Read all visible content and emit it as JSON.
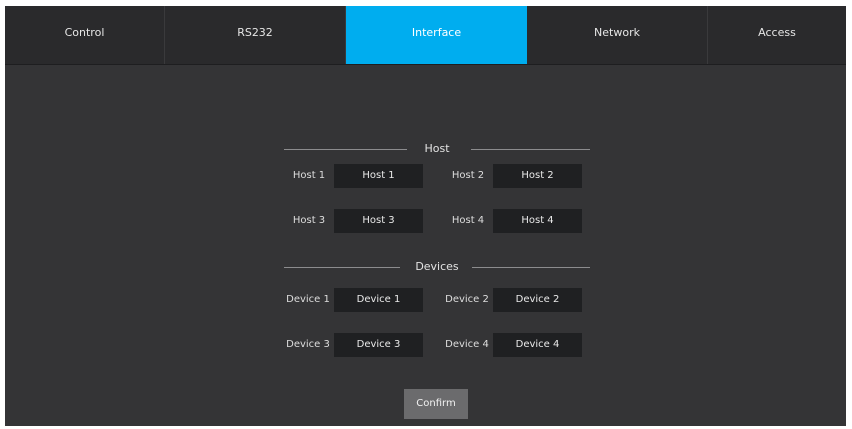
{
  "tabs": [
    {
      "label": "Control"
    },
    {
      "label": "RS232"
    },
    {
      "label": "Interface",
      "active": true
    },
    {
      "label": "Network"
    },
    {
      "label": "Access"
    }
  ],
  "host_section": {
    "title": "Host",
    "items": [
      {
        "label": "Host 1",
        "value": "Host 1"
      },
      {
        "label": "Host 2",
        "value": "Host 2"
      },
      {
        "label": "Host 3",
        "value": "Host 3"
      },
      {
        "label": "Host 4",
        "value": "Host 4"
      }
    ]
  },
  "devices_section": {
    "title": "Devices",
    "items": [
      {
        "label": "Device 1",
        "value": "Device 1"
      },
      {
        "label": "Device 2",
        "value": "Device 2"
      },
      {
        "label": "Device 3",
        "value": "Device 3"
      },
      {
        "label": "Device 4",
        "value": "Device 4"
      }
    ]
  },
  "confirm_label": "Confirm",
  "colors": {
    "accent": "#00adef",
    "panel": "#343436",
    "field": "#1f2022"
  }
}
